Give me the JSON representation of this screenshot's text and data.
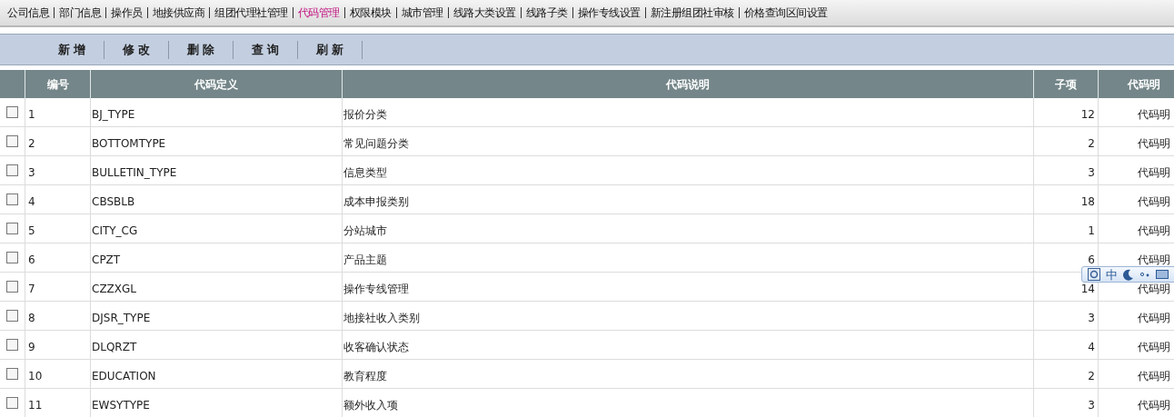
{
  "nav": [
    {
      "label": "公司信息",
      "selected": false
    },
    {
      "label": "部门信息",
      "selected": false
    },
    {
      "label": "操作员",
      "selected": false
    },
    {
      "label": "地接供应商",
      "selected": false
    },
    {
      "label": "组团代理社管理",
      "selected": false
    },
    {
      "label": "代码管理",
      "selected": true
    },
    {
      "label": "权限模块",
      "selected": false
    },
    {
      "label": "城市管理",
      "selected": false
    },
    {
      "label": "线路大类设置",
      "selected": false
    },
    {
      "label": "线路子类",
      "selected": false
    },
    {
      "label": "操作专线设置",
      "selected": false
    },
    {
      "label": "新注册组团社审核",
      "selected": false
    },
    {
      "label": "价格查询区间设置",
      "selected": false
    }
  ],
  "toolbar": [
    "新 增",
    "修 改",
    "删 除",
    "查 询",
    "刷 新"
  ],
  "table": {
    "columns": [
      "编号",
      "代码定义",
      "代码说明",
      "子项",
      "代码明"
    ],
    "rows": [
      {
        "checked": false,
        "cells": [
          "1",
          "BJ_TYPE",
          "报价分类",
          "12",
          "代码明"
        ]
      },
      {
        "checked": false,
        "cells": [
          "2",
          "BOTTOMTYPE",
          "常见问题分类",
          "2",
          "代码明"
        ]
      },
      {
        "checked": false,
        "cells": [
          "3",
          "BULLETIN_TYPE",
          "信息类型",
          "3",
          "代码明"
        ]
      },
      {
        "checked": false,
        "cells": [
          "4",
          "CBSBLB",
          "成本申报类别",
          "18",
          "代码明"
        ]
      },
      {
        "checked": false,
        "cells": [
          "5",
          "CITY_CG",
          "分站城市",
          "1",
          "代码明"
        ]
      },
      {
        "checked": false,
        "cells": [
          "6",
          "CPZT",
          "产品主题",
          "6",
          "代码明"
        ]
      },
      {
        "checked": false,
        "cells": [
          "7",
          "CZZXGL",
          "操作专线管理",
          "14",
          "代码明"
        ]
      },
      {
        "checked": false,
        "cells": [
          "8",
          "DJSR_TYPE",
          "地接社收入类别",
          "3",
          "代码明"
        ]
      },
      {
        "checked": false,
        "cells": [
          "9",
          "DLQRZT",
          "收客确认状态",
          "4",
          "代码明"
        ]
      },
      {
        "checked": false,
        "cells": [
          "10",
          "EDUCATION",
          "教育程度",
          "2",
          "代码明"
        ]
      },
      {
        "checked": false,
        "cells": [
          "11",
          "EWSYTYPE",
          "额外收入项",
          "3",
          "代码明"
        ]
      }
    ]
  },
  "ime_toolbar": {
    "label": "中"
  }
}
